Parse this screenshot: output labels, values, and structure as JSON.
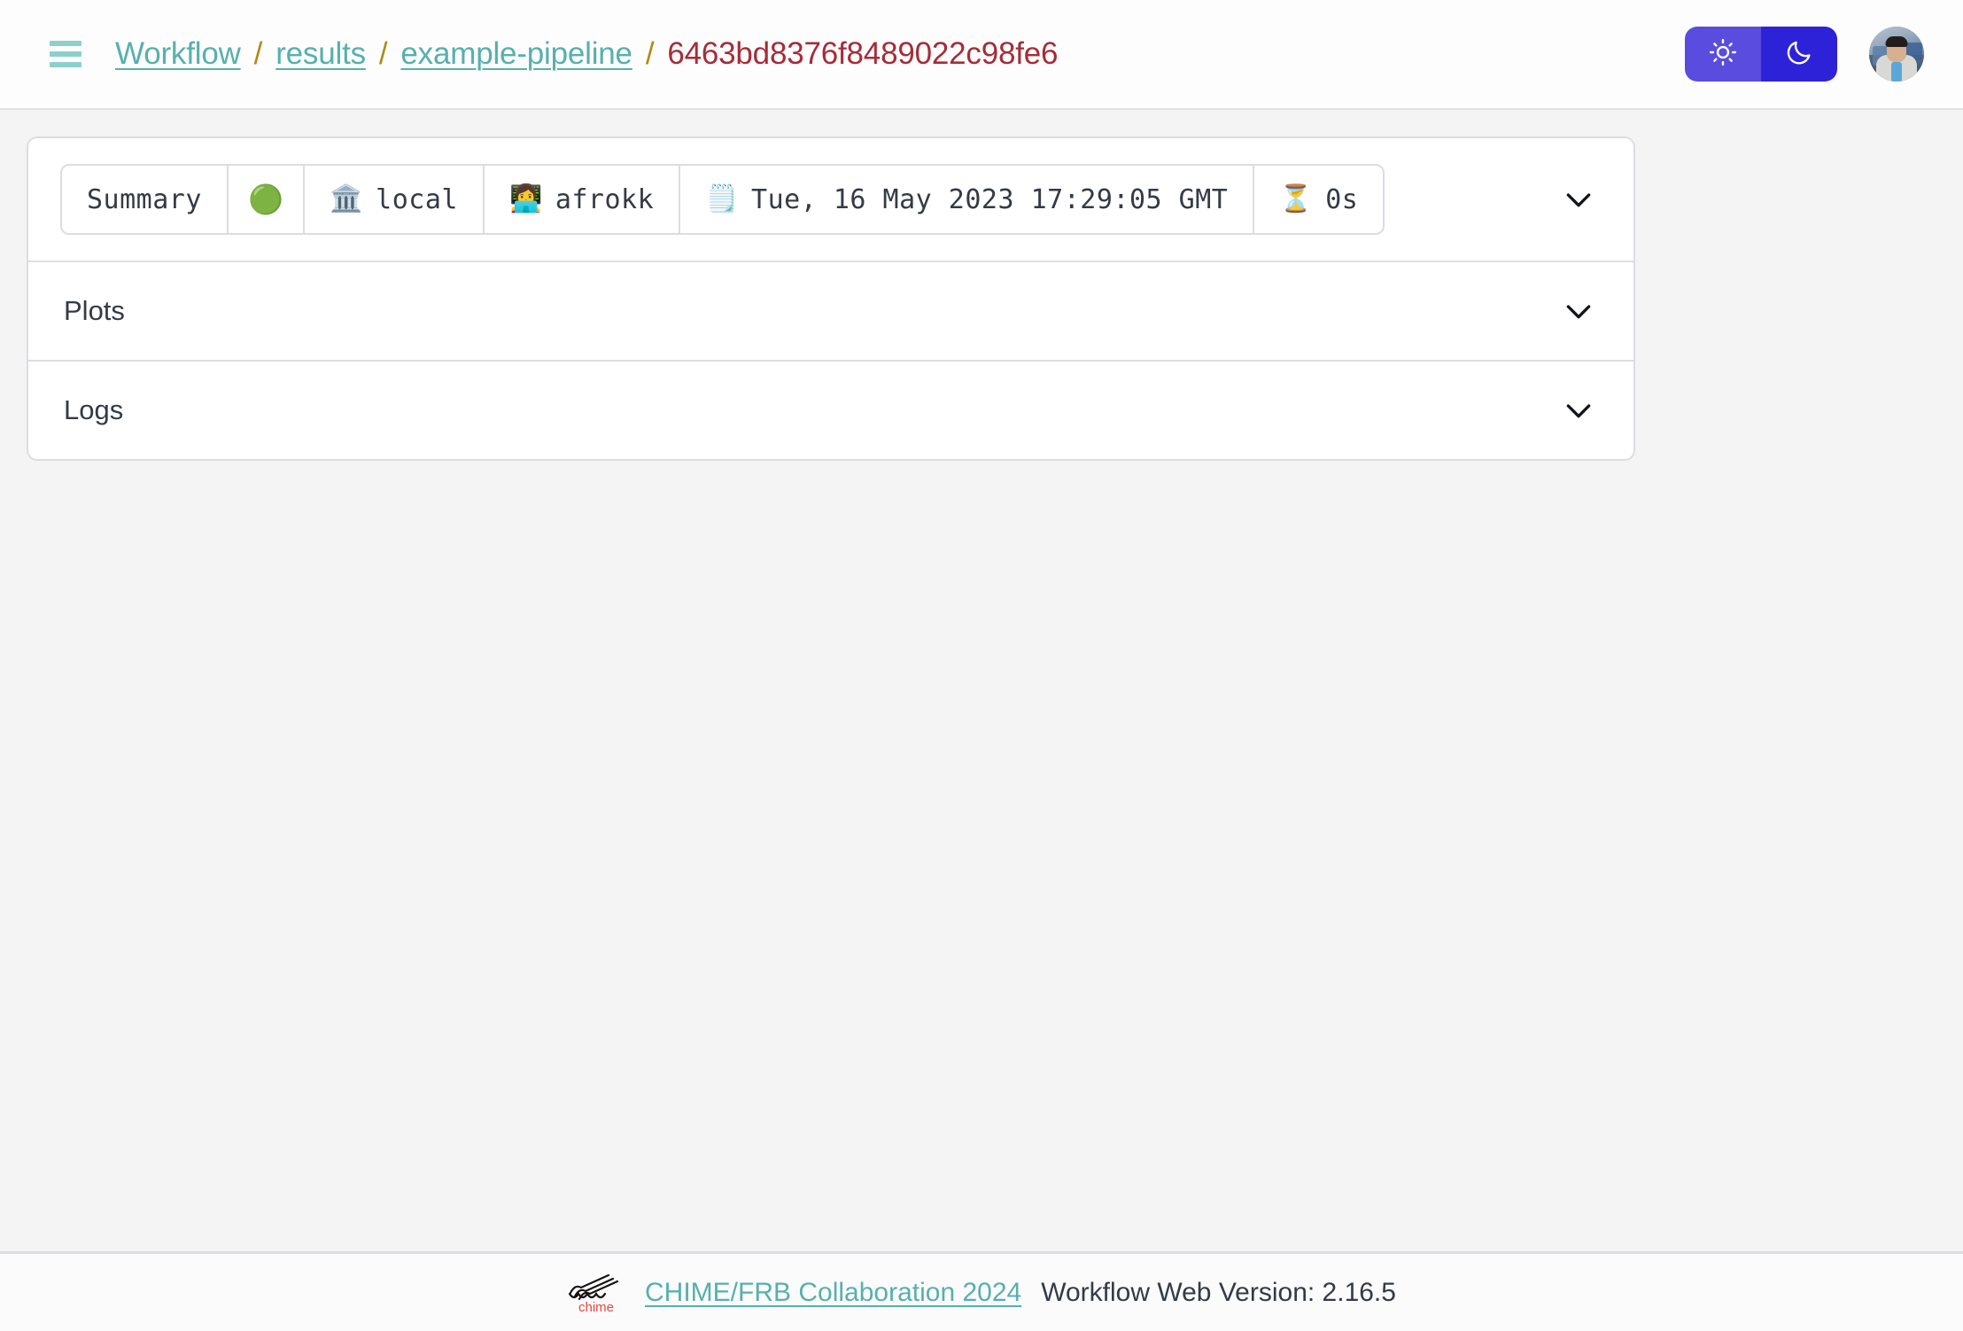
{
  "header": {
    "menu_icon": "hamburger-icon",
    "breadcrumb": {
      "separator": "/",
      "items": [
        {
          "label": "Workflow",
          "type": "link"
        },
        {
          "label": "results",
          "type": "link"
        },
        {
          "label": "example-pipeline",
          "type": "link"
        },
        {
          "label": "6463bd8376f8489022c98fe6",
          "type": "current"
        }
      ]
    },
    "theme_toggle": {
      "light_icon": "sun-icon",
      "dark_icon": "moon-icon",
      "light_color": "#5b4ce0",
      "dark_color": "#2e22d8",
      "active": "light"
    },
    "avatar": "user-avatar"
  },
  "main": {
    "sections": [
      {
        "id": "summary",
        "title": "Summary",
        "expanded": false,
        "chevron": "chevron-down-icon",
        "cells": [
          {
            "name": "summary-label",
            "emoji": "",
            "text": "Summary"
          },
          {
            "name": "status",
            "emoji": "🟢",
            "text": ""
          },
          {
            "name": "site",
            "emoji": "🏛️",
            "text": "local"
          },
          {
            "name": "user",
            "emoji": "👩‍💻",
            "text": "afrokk"
          },
          {
            "name": "creation-time",
            "emoji": "🗒️",
            "text": "Tue, 16 May 2023 17:29:05 GMT"
          },
          {
            "name": "duration",
            "emoji": "⏳",
            "text": "0s"
          }
        ]
      },
      {
        "id": "plots",
        "title": "Plots",
        "expanded": false,
        "chevron": "chevron-down-icon"
      },
      {
        "id": "logs",
        "title": "Logs",
        "expanded": false,
        "chevron": "chevron-down-icon"
      }
    ]
  },
  "footer": {
    "logo": "chime-logo",
    "logo_text": "chime",
    "link": "CHIME/FRB Collaboration 2024",
    "version": "Workflow Web Version: 2.16.5"
  },
  "colors": {
    "page_background": "#f4f4f5",
    "card_background": "#ffffff",
    "border": "#dcdde2",
    "link_teal": "#57b0ad",
    "breadcrumb_separator": "#b08a17",
    "breadcrumb_current": "#a62c38",
    "text": "#343a46",
    "status_green": "#3fb83f",
    "logo_red": "#e8453c"
  }
}
